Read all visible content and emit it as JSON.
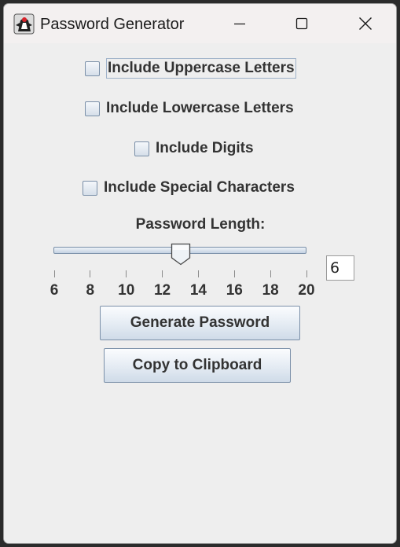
{
  "window": {
    "title": "Password Generator",
    "icon": "java-duke-icon"
  },
  "options": [
    {
      "label": "Include Uppercase Letters",
      "checked": false,
      "focused": true
    },
    {
      "label": "Include Lowercase Letters",
      "checked": false,
      "focused": false
    },
    {
      "label": "Include Digits",
      "checked": false,
      "focused": false
    },
    {
      "label": "Include Special Characters",
      "checked": false,
      "focused": false
    }
  ],
  "length": {
    "label": "Password Length:",
    "slider_min": 6,
    "slider_max": 20,
    "slider_value": 13,
    "ticks": [
      "6",
      "8",
      "10",
      "12",
      "14",
      "16",
      "18",
      "20"
    ],
    "field_value": "6"
  },
  "buttons": {
    "generate": "Generate Password",
    "copy": "Copy to Clipboard"
  }
}
